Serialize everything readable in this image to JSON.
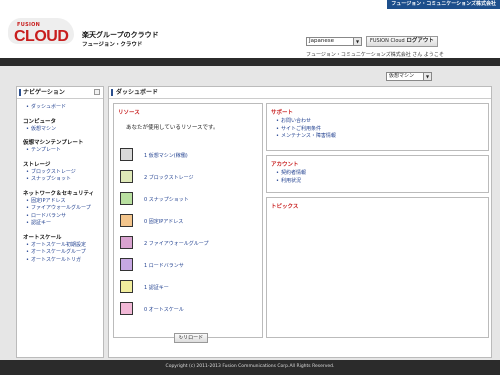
{
  "header": {
    "corp_label": "フュージョン・コミュニケーションズ株式会社",
    "logo_small": "FUSION",
    "logo_big": "CLOUD",
    "title": "楽天グループのクラウド",
    "subtitle": "フュージョン・クラウド",
    "language": "Japanese",
    "logout_prefix": "FUSION Cloud",
    "logout_label": "ログアウト",
    "user_line": "フュージョン・コミュニケーションズ株式会社 さん ようこそ"
  },
  "env_selector": "仮想マシン",
  "nav": {
    "title": "ナビゲーション",
    "groups": [
      {
        "title": "",
        "items": [
          "ダッシュボード"
        ]
      },
      {
        "title": "コンピュータ",
        "items": [
          "仮想マシン"
        ]
      },
      {
        "title": "仮想マシンテンプレート",
        "items": [
          "テンプレート"
        ]
      },
      {
        "title": "ストレージ",
        "items": [
          "ブロックストレージ",
          "スナップショット"
        ]
      },
      {
        "title": "ネットワーク＆セキュリティ",
        "items": [
          "固定IPアドレス",
          "ファイアウォールグループ",
          "ロードバランサ",
          "認証キー"
        ]
      },
      {
        "title": "オートスケール",
        "items": [
          "オートスケール初期設定",
          "オートスケールグループ",
          "オートスケールトリガ"
        ]
      }
    ]
  },
  "dashboard": {
    "title": "ダッシュボード",
    "resources_title": "リソース",
    "resources_intro": "あなたが使用しているリソースです。",
    "resources": [
      {
        "icon": "virtual-machine-icon",
        "label": "1 仮想マシン(稼働)",
        "color": "#d9d9d9"
      },
      {
        "icon": "block-storage-icon",
        "label": "2 ブロックストレージ",
        "color": "#dfe9b8"
      },
      {
        "icon": "snapshot-icon",
        "label": "0 スナップショット",
        "color": "#b9e0a0"
      },
      {
        "icon": "fixed-ip-icon",
        "label": "0 固定IPアドレス",
        "color": "#f3c58c"
      },
      {
        "icon": "firewall-icon",
        "label": "2 ファイアウォールグループ",
        "color": "#d9a3d0"
      },
      {
        "icon": "load-balancer-icon",
        "label": "1 ロードバランサ",
        "color": "#c7a8e3"
      },
      {
        "icon": "auth-key-icon",
        "label": "1 認証キー",
        "color": "#f2ee9e"
      },
      {
        "icon": "auto-scale-icon",
        "label": "0 オートスケール",
        "color": "#f1b8d6"
      }
    ],
    "reload_label": "リロード",
    "support_title": "サポート",
    "support_links": [
      "お問い合わせ",
      "サイトご利用条件",
      "メンテナンス・障害情報"
    ],
    "account_title": "アカウント",
    "account_links": [
      "契約者情報",
      "利用状況"
    ],
    "topics_title": "トピックス"
  },
  "footer": {
    "copyright": "Copyright (c) 2011-2013 Fusion Communications Corp.All Rights Reserved."
  }
}
